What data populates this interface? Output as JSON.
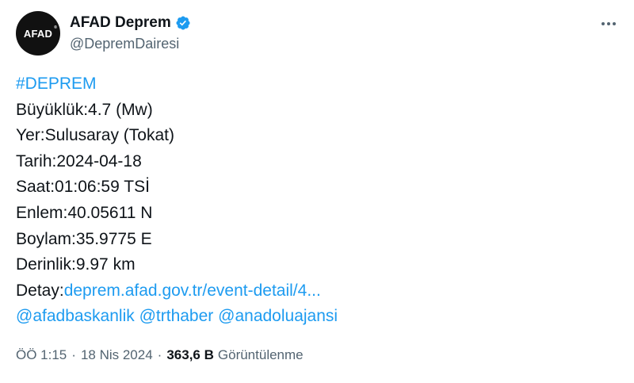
{
  "author": {
    "display_name": "AFAD Deprem",
    "handle": "@DepremDairesi",
    "avatar_text": "AFAD",
    "avatar_reg": "®",
    "verified_color": "#1d9bf0"
  },
  "menu": {
    "more_icon": "more-horizontal-icon"
  },
  "tweet": {
    "hashtag": "#DEPREM",
    "magnitude_label": "Büyüklük:",
    "magnitude_value": "4.7 (Mw)",
    "location_label": "Yer:",
    "location_value": "Sulusaray (Tokat)",
    "date_label": "Tarih:",
    "date_value": "2024-04-18",
    "time_label": "Saat:",
    "time_value": "01:06:59 TSİ",
    "lat_label": "Enlem:",
    "lat_value": "40.05611 N",
    "lon_label": "Boylam:",
    "lon_value": "35.9775 E",
    "depth_label": "Derinlik:",
    "depth_value": "9.97 km",
    "detail_label": "Detay:",
    "detail_link": "deprem.afad.gov.tr/event-detail/4...",
    "mentions": [
      "@afadbaskanlik",
      "@trthaber",
      "@anadoluajansi"
    ]
  },
  "meta": {
    "time": "ÖÖ 1:15",
    "separator": "·",
    "date": "18 Nis 2024",
    "views_count": "363,6 B",
    "views_label": "Görüntülenme"
  },
  "colors": {
    "link": "#1d9bf0",
    "text": "#0f1419",
    "muted": "#536471"
  }
}
